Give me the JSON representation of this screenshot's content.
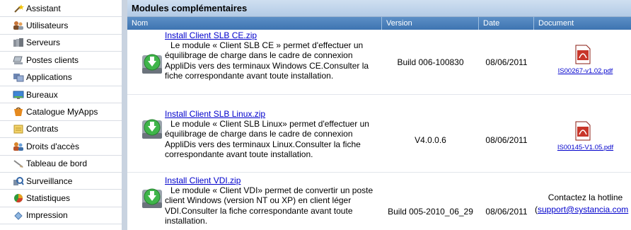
{
  "sidebar": {
    "items": [
      {
        "label": "Assistant",
        "icon": "magic-wand-icon"
      },
      {
        "label": "Utilisateurs",
        "icon": "users-icon"
      },
      {
        "label": "Serveurs",
        "icon": "servers-icon"
      },
      {
        "label": "Postes clients",
        "icon": "client-computer-icon"
      },
      {
        "label": "Applications",
        "icon": "applications-icon"
      },
      {
        "label": "Bureaux",
        "icon": "desktop-icon"
      },
      {
        "label": "Catalogue MyApps",
        "icon": "catalog-icon"
      },
      {
        "label": "Contrats",
        "icon": "contract-icon"
      },
      {
        "label": "Droits d'accès",
        "icon": "access-rights-icon"
      },
      {
        "label": "Tableau de bord",
        "icon": "dashboard-icon"
      },
      {
        "label": "Surveillance",
        "icon": "monitoring-icon"
      },
      {
        "label": "Statistiques",
        "icon": "statistics-icon"
      },
      {
        "label": "Impression",
        "icon": "print-icon"
      }
    ]
  },
  "panel": {
    "title": "Modules complémentaires",
    "columns": {
      "name": "Nom",
      "version": "Version",
      "date": "Date",
      "document": "Document"
    },
    "rows": [
      {
        "link": "Install Client SLB CE.zip",
        "description": "Le module « Client SLB CE » permet d'effectuer un équilibrage de charge dans le cadre de connexion AppliDis vers des terminaux Windows CE.Consulter la fiche correspondante avant toute installation.",
        "version": "Build 006-100830",
        "date": "08/06/2011",
        "document": "IS00267-v1.02.pdf",
        "icon": "package-install-icon"
      },
      {
        "link": "Install Client SLB Linux.zip",
        "description": "Le module « Client SLB Linux» permet d'effectuer un équilibrage de charge dans le cadre de connexion AppliDis vers des terminaux Linux.Consulter la fiche correspondante avant toute installation.",
        "version": "V4.0.0.6",
        "date": "08/06/2011",
        "document": "IS00145-V1.05.pdf",
        "icon": "package-install-icon"
      },
      {
        "link": "Install Client VDI.zip",
        "description": "Le module « Client VDI» permet de convertir un poste client Windows (version NT ou XP) en client léger VDI.Consulter la fiche correspondante avant toute installation.",
        "version": "Build 005-2010_06_29",
        "date": "08/06/2011",
        "contact_text": "Contactez la hotline",
        "contact_open": "(",
        "contact_link": "support@systancia.com",
        "icon": "package-install-icon"
      }
    ]
  },
  "colors": {
    "header_bg": "#4a7fbb",
    "title_bg": "#c3d6ec",
    "link": "#0000cc",
    "divider": "#c9d3e0"
  }
}
